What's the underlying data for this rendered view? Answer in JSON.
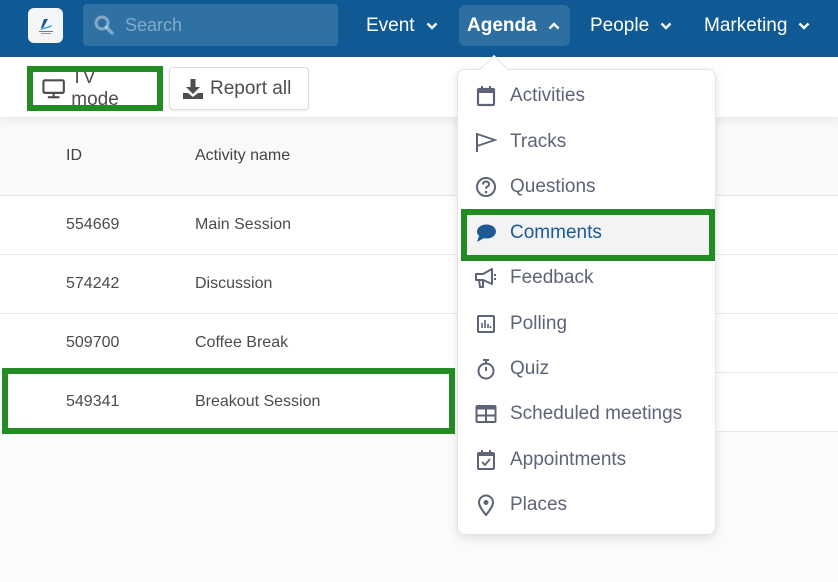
{
  "header": {
    "logo_alt": "event-logo",
    "search": {
      "placeholder": "Search",
      "value": ""
    },
    "nav": [
      {
        "label": "Event",
        "state": "collapsed"
      },
      {
        "label": "Agenda",
        "state": "expanded"
      },
      {
        "label": "People",
        "state": "collapsed"
      },
      {
        "label": "Marketing",
        "state": "collapsed"
      }
    ]
  },
  "toolbar": {
    "tv_mode_label": "TV mode",
    "report_all_label": "Report all"
  },
  "table": {
    "columns": [
      "ID",
      "Activity name"
    ],
    "rows": [
      {
        "id": "554669",
        "name": "Main Session"
      },
      {
        "id": "574242",
        "name": "Discussion"
      },
      {
        "id": "509700",
        "name": "Coffee Break"
      },
      {
        "id": "549341",
        "name": "Breakout Session"
      }
    ]
  },
  "agenda_menu": {
    "items": [
      {
        "label": "Activities",
        "icon": "calendar-icon"
      },
      {
        "label": "Tracks",
        "icon": "flag-icon"
      },
      {
        "label": "Questions",
        "icon": "question-circle-icon"
      },
      {
        "label": "Comments",
        "icon": "comment-icon",
        "active": true
      },
      {
        "label": "Feedback",
        "icon": "megaphone-icon"
      },
      {
        "label": "Polling",
        "icon": "poll-chart-icon"
      },
      {
        "label": "Quiz",
        "icon": "stopwatch-icon"
      },
      {
        "label": "Scheduled meetings",
        "icon": "table-grid-icon"
      },
      {
        "label": "Appointments",
        "icon": "calendar-check-icon"
      },
      {
        "label": "Places",
        "icon": "map-pin-icon"
      }
    ]
  },
  "colors": {
    "nav_bg": "#0f5a94",
    "highlight": "#228b22",
    "active_menu_text": "#1c5a93"
  }
}
